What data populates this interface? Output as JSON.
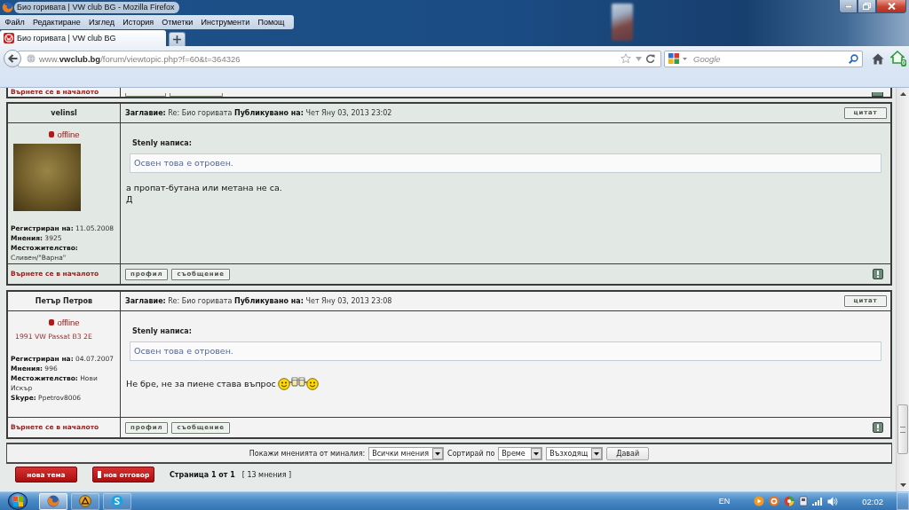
{
  "window": {
    "title": "Био горивата | VW club BG - Mozilla Firefox"
  },
  "menu": [
    "Файл",
    "Редактиране",
    "Изглед",
    "История",
    "Отметки",
    "Инструменти",
    "Помощ"
  ],
  "tabs": [
    {
      "label": "Био горивата | VW club BG",
      "selected": true
    }
  ],
  "address": {
    "url": "www.**vwclub.bg**/forum/viewtopic.php?f=60&t=364326"
  },
  "search": {
    "placeholder": "Google"
  },
  "addon": {
    "count": "0"
  },
  "previous_post": {
    "back_link": "Върнете се в началото"
  },
  "posts": [
    {
      "author": "velinsl",
      "header": "**Заглавие:** Re: Био горивата **Публикувано на:** Чет Яну 03, 2013 23:02",
      "quote_button": "цитат",
      "online": false,
      "status": "offline",
      "avatar": true,
      "profile": [
        "**Регистриран на:** 11.05.2008",
        "**Мнения:** 3925",
        "**Местожителство:** Сливен/\"Варна\""
      ],
      "quote": {
        "author": "Stenly написа:",
        "text": "Освен това е отровен."
      },
      "message": [
        "а пропат-бутана или метана не са.",
        "Д"
      ],
      "smiley": false,
      "back_link": "Върнете се в началото",
      "buttons": [
        "профил",
        "съобщение"
      ]
    },
    {
      "author": "Петър Петров",
      "header": "**Заглавие:** Re: Био горивата **Публикувано на:** Чет Яну 03, 2013 23:08",
      "quote_button": "цитат",
      "online": false,
      "status": "offline",
      "avatar": false,
      "user_title": "1991 VW Passat B3 2E",
      "profile": [
        "**Регистриран на:** 04.07.2007",
        "**Мнения:** 996",
        "**Местожителство:** Нови Искър",
        "**Skype:** Ppetrov8006"
      ],
      "quote": {
        "author": "Stenly написа:",
        "text": "Освен това е отровен."
      },
      "message": [
        "Не бре, не за пиене става въпрос"
      ],
      "smiley": true,
      "back_link": "Върнете се в началото",
      "buttons": [
        "профил",
        "съобщение"
      ]
    }
  ],
  "sort_bar": {
    "items": [
      {
        "kind": "label",
        "text": "Покажи мненията от миналия:"
      },
      {
        "kind": "select",
        "text": "Всички мнения"
      },
      {
        "kind": "label",
        "text": "Сортирай по"
      },
      {
        "kind": "select",
        "text": "Време"
      },
      {
        "kind": "select",
        "text": "Възходящ"
      },
      {
        "kind": "button",
        "text": "Давай"
      }
    ]
  },
  "actions": [
    {
      "label": "нова тема",
      "icon": false
    },
    {
      "label": "нов отговор",
      "icon": true
    }
  ],
  "pagination": {
    "page": "Страница 1 от 1",
    "count": "[ 13 мнения ]"
  },
  "taskbar": {
    "apps": [
      {
        "kind": "browser",
        "selected": true
      },
      {
        "kind": "player",
        "selected": false
      },
      {
        "kind": "chat",
        "selected": false
      }
    ],
    "language": "EN",
    "clock": "02:02"
  }
}
